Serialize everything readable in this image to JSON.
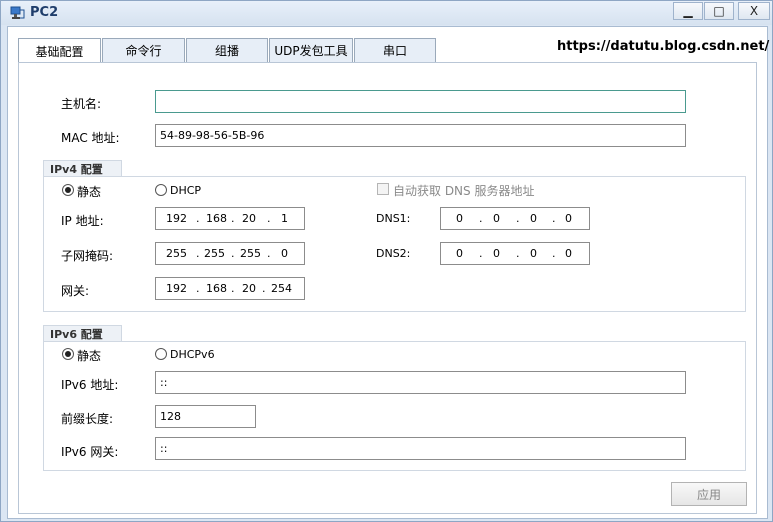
{
  "window": {
    "title": "PC2",
    "min_label": "▁",
    "max_label": "□",
    "close_label": "X"
  },
  "tabs": [
    {
      "label": "基础配置"
    },
    {
      "label": "命令行"
    },
    {
      "label": "组播"
    },
    {
      "label": "UDP发包工具"
    },
    {
      "label": "串口"
    }
  ],
  "watermark": "https://datutu.blog.csdn.net/",
  "basic": {
    "hostname_label": "主机名:",
    "hostname_value": "",
    "mac_label": "MAC 地址:",
    "mac_value": "54-89-98-56-5B-96"
  },
  "ipv4": {
    "title": "IPv4 配置",
    "static_label": "静态",
    "dhcp_label": "DHCP",
    "auto_dns_label": "自动获取 DNS 服务器地址",
    "ip_label": "IP 地址:",
    "ip": [
      "192",
      "168",
      "20",
      "1"
    ],
    "mask_label": "子网掩码:",
    "mask": [
      "255",
      "255",
      "255",
      "0"
    ],
    "gateway_label": "网关:",
    "gateway": [
      "192",
      "168",
      "20",
      "254"
    ],
    "dns1_label": "DNS1:",
    "dns1": [
      "0",
      "0",
      "0",
      "0"
    ],
    "dns2_label": "DNS2:",
    "dns2": [
      "0",
      "0",
      "0",
      "0"
    ]
  },
  "ipv6": {
    "title": "IPv6 配置",
    "static_label": "静态",
    "dhcp_label": "DHCPv6",
    "addr_label": "IPv6 地址:",
    "addr_value": "::",
    "prefix_label": "前缀长度:",
    "prefix_value": "128",
    "gateway_label": "IPv6 网关:",
    "gateway_value": "::"
  },
  "apply_label": "应用"
}
